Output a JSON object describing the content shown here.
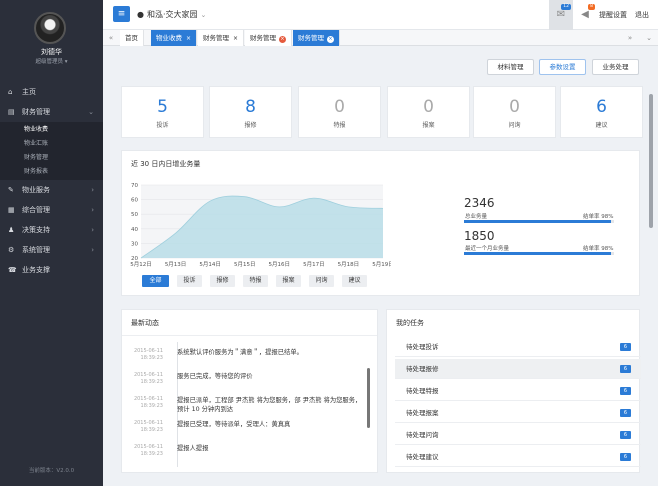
{
  "user": {
    "name": "刘德华",
    "role": "超级管理员 ▾"
  },
  "nav": {
    "home": "主页",
    "finance": "财务管理",
    "finance_sub": [
      "物业收费",
      "物业汇账",
      "财务管理",
      "财务报表"
    ],
    "property_service": "物业服务",
    "general": "综合管理",
    "decision": "决策支持",
    "system": "系统管理",
    "business": "业务支撑"
  },
  "version": "当前版本：V2.0.0",
  "topbar": {
    "location": "和泓·交大家园",
    "msg_count": "12",
    "bell_count": "8",
    "remind": "提醒设置",
    "logout": "退出"
  },
  "tabs": [
    "首页",
    "物业收费",
    "财务管理",
    "财务管理",
    "财务管理"
  ],
  "actions": {
    "materials": "材料管理",
    "params": "参数设置",
    "business": "业务处理"
  },
  "stats": [
    {
      "num": "5",
      "label": "投诉"
    },
    {
      "num": "8",
      "label": "报修"
    },
    {
      "num": "0",
      "label": "特报"
    },
    {
      "num": "0",
      "label": "报案"
    },
    {
      "num": "0",
      "label": "问询"
    },
    {
      "num": "6",
      "label": "建议"
    }
  ],
  "trend_title": "近 30 日内日增业务量",
  "chart_data": {
    "type": "area",
    "x": [
      "5月12日",
      "5月13日",
      "5月14日",
      "5月15日",
      "5月16日",
      "5月17日",
      "5月18日",
      "5月19日"
    ],
    "y": [
      20,
      37,
      59,
      62,
      55,
      61,
      55,
      54
    ],
    "ylim": [
      20,
      70
    ],
    "yticks": [
      20,
      30,
      40,
      50,
      60,
      70
    ],
    "grid": true
  },
  "filters": [
    "全部",
    "投诉",
    "报修",
    "特报",
    "报案",
    "问询",
    "建议"
  ],
  "kpis": [
    {
      "num": "2346",
      "label": "总业务量",
      "rate": "结单率 98%",
      "rate_value": 0.98
    },
    {
      "num": "1850",
      "label": "最近一个月业务量",
      "rate": "结单率 98%",
      "rate_value": 0.98
    }
  ],
  "news_title": "最新动态",
  "news": [
    {
      "date": "2015-06-11",
      "time": "18:39:23",
      "text": "系统默认评价服务为＂满意＂，提报已结单。"
    },
    {
      "date": "2015-06-11",
      "time": "18:39:23",
      "text": "服务已完成，等待您的评价"
    },
    {
      "date": "2015-06-11",
      "time": "18:39:23",
      "text": "提报已派单，工程部 尹杰熊 将为您服务，部 尹杰熊 将为您服务，预计 10 分钟内到达"
    },
    {
      "date": "2015-06-11",
      "time": "18:39:23",
      "text": "提报已受理，等待派单，受理人：黄真真"
    },
    {
      "date": "2015-06-11",
      "time": "18:39:23",
      "text": "提报人提报"
    }
  ],
  "tasks_title": "我的任务",
  "tasks": [
    {
      "label": "待处理投诉",
      "count": "6"
    },
    {
      "label": "待处理报修",
      "count": "6"
    },
    {
      "label": "待处理特报",
      "count": "6"
    },
    {
      "label": "待处理报案",
      "count": "6"
    },
    {
      "label": "待处理问询",
      "count": "6"
    },
    {
      "label": "待处理建议",
      "count": "6"
    }
  ]
}
